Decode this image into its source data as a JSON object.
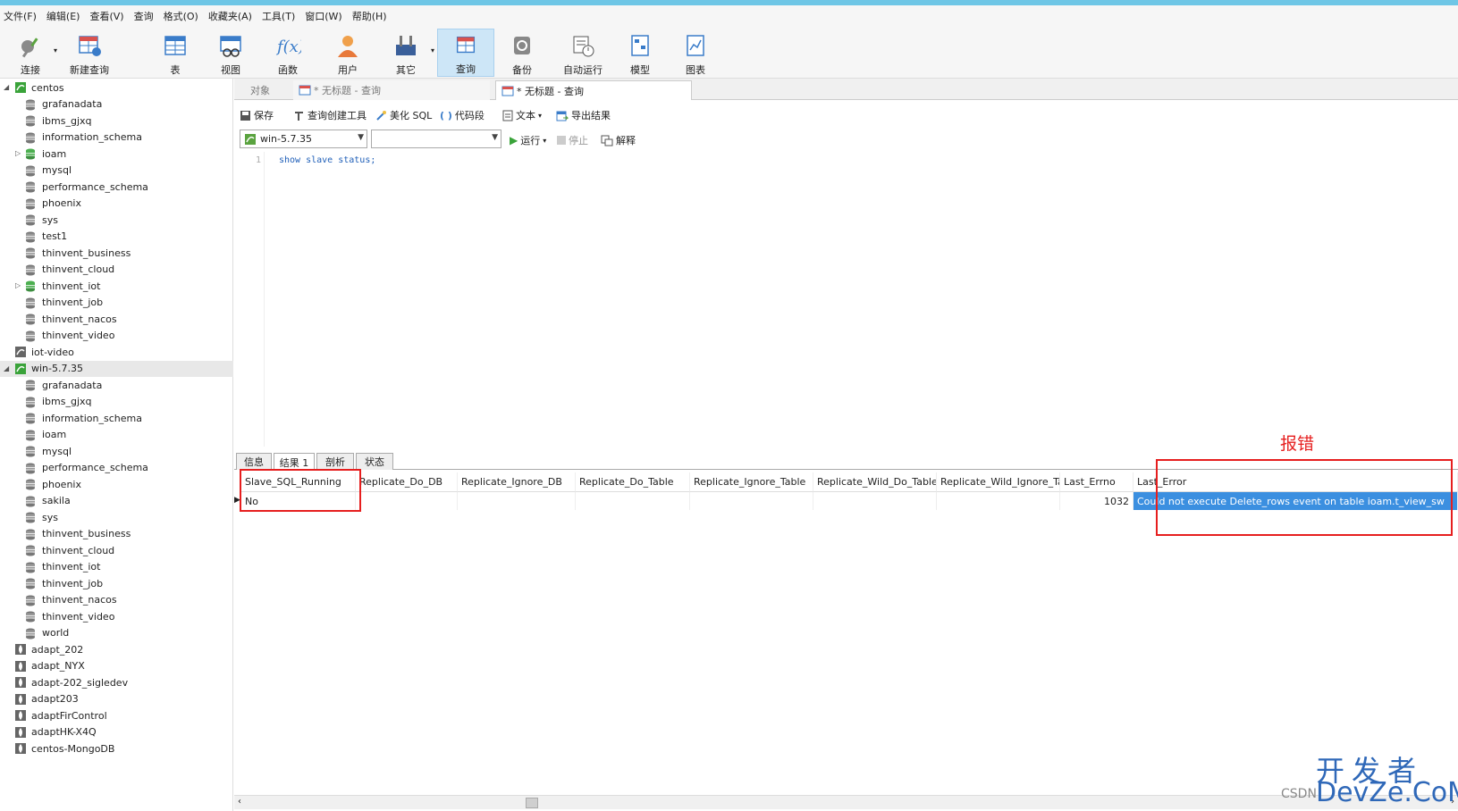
{
  "menu": [
    "文件(F)",
    "编辑(E)",
    "查看(V)",
    "查询",
    "格式(O)",
    "收藏夹(A)",
    "工具(T)",
    "窗口(W)",
    "帮助(H)"
  ],
  "toolbar": {
    "connect": "连接",
    "new_query": "新建查询",
    "table": "表",
    "view": "视图",
    "function": "函数",
    "user": "用户",
    "other": "其它",
    "query": "查询",
    "backup": "备份",
    "autorun": "自动运行",
    "model": "模型",
    "chart": "图表"
  },
  "sidebar": {
    "groups": [
      {
        "label": "centos",
        "children": [
          "grafanadata",
          "ibms_gjxq",
          "information_schema",
          "ioam",
          "mysql",
          "performance_schema",
          "phoenix",
          "sys",
          "test1",
          "thinvent_business",
          "thinvent_cloud",
          "thinvent_iot",
          "thinvent_job",
          "thinvent_nacos",
          "thinvent_video"
        ]
      },
      {
        "label": "iot-video",
        "children": []
      },
      {
        "label": "win-5.7.35",
        "children": [
          "grafanadata",
          "ibms_gjxq",
          "information_schema",
          "ioam",
          "mysql",
          "performance_schema",
          "phoenix",
          "sakila",
          "sys",
          "thinvent_business",
          "thinvent_cloud",
          "thinvent_iot",
          "thinvent_job",
          "thinvent_nacos",
          "thinvent_video",
          "world"
        ]
      }
    ],
    "others": [
      "adapt_202",
      "adapt_NYX",
      "adapt-202_sigledev",
      "adapt203",
      "adaptFirControl",
      "adaptHK-X4Q",
      "centos-MongoDB"
    ]
  },
  "tabs": {
    "objects": "对象",
    "tab1": "* 无标题 - 查询",
    "tab2": "* 无标题 - 查询"
  },
  "querybar": {
    "save": "保存",
    "builder": "查询创建工具",
    "beautify": "美化 SQL",
    "snippet": "代码段",
    "text": "文本",
    "export": "导出结果"
  },
  "selectbar": {
    "connection": "win-5.7.35",
    "database": "",
    "run": "运行",
    "stop": "停止",
    "explain": "解释"
  },
  "editor": {
    "line": "1",
    "code": "show slave status;"
  },
  "result_tabs": {
    "info": "信息",
    "result": "结果 1",
    "profile": "剖析",
    "status": "状态"
  },
  "grid": {
    "headers": [
      "Slave_SQL_Running",
      "Replicate_Do_DB",
      "Replicate_Ignore_DB",
      "Replicate_Do_Table",
      "Replicate_Ignore_Table",
      "Replicate_Wild_Do_Table",
      "Replicate_Wild_Ignore_Ta",
      "Last_Errno",
      "Last_Error"
    ],
    "row": [
      "No",
      "",
      "",
      "",
      "",
      "",
      "",
      "1032",
      "Could not execute Delete_rows event on table ioam.t_view_sw"
    ]
  },
  "annotation": "报错",
  "watermark": {
    "line1": "开发者",
    "line2": "DevZe.CoM",
    "csdn": "CSDN"
  },
  "colors": {
    "accent": "#cde6f7",
    "highlight": "#e61e1e",
    "selection": "#3b8fe0"
  }
}
